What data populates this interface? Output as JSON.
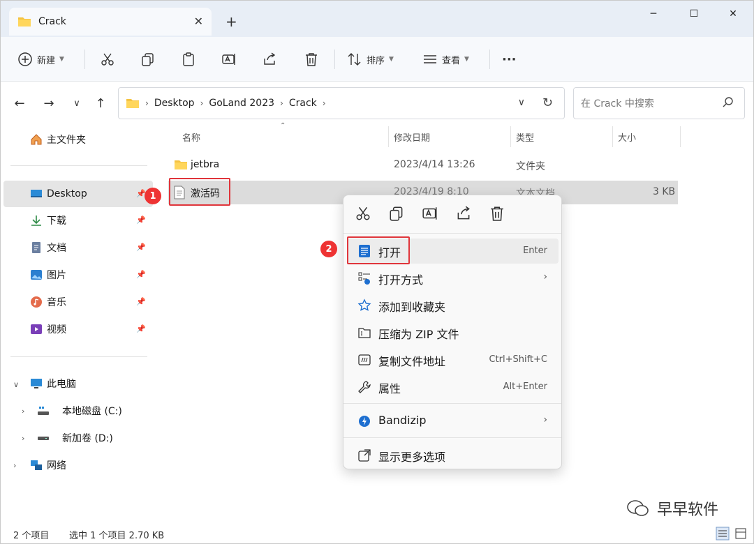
{
  "window": {
    "tab_title": "Crack",
    "new_tab": "+",
    "minimize": "─",
    "maximize": "☐",
    "close": "✕",
    "tab_close": "✕"
  },
  "toolbar": {
    "new_label": "新建",
    "sort_label": "排序",
    "view_label": "查看",
    "more_label": "···"
  },
  "address": {
    "crumbs": [
      "Desktop",
      "GoLand 2023",
      "Crack"
    ],
    "search_placeholder": "在 Crack 中搜索"
  },
  "sidebar": {
    "home": "主文件夹",
    "quick": [
      {
        "label": "Desktop",
        "icon": "desktop-icon"
      },
      {
        "label": "下载",
        "icon": "download-icon"
      },
      {
        "label": "文档",
        "icon": "document-icon"
      },
      {
        "label": "图片",
        "icon": "picture-icon"
      },
      {
        "label": "音乐",
        "icon": "music-icon"
      },
      {
        "label": "视频",
        "icon": "video-icon"
      }
    ],
    "this_pc": "此电脑",
    "drives": [
      {
        "label": "本地磁盘 (C:)"
      },
      {
        "label": "新加卷 (D:)"
      }
    ],
    "network": "网络"
  },
  "columns": {
    "name": "名称",
    "modified": "修改日期",
    "type": "类型",
    "size": "大小"
  },
  "files": [
    {
      "name": "jetbra",
      "modified": "2023/4/14 13:26",
      "type": "文件夹",
      "size": ""
    },
    {
      "name": "激活码",
      "modified": "2023/4/19 8:10",
      "type": "文本文档",
      "size": "3 KB"
    }
  ],
  "badges": {
    "one": "1",
    "two": "2"
  },
  "context_menu": {
    "items": [
      {
        "label": "打开",
        "shortcut": "Enter",
        "icon": "notepad-icon"
      },
      {
        "label": "打开方式",
        "shortcut": "",
        "icon": "open-with-icon"
      },
      {
        "label": "添加到收藏夹",
        "shortcut": "",
        "icon": "star-icon"
      },
      {
        "label": "压缩为 ZIP 文件",
        "shortcut": "",
        "icon": "zip-icon"
      },
      {
        "label": "复制文件地址",
        "shortcut": "Ctrl+Shift+C",
        "icon": "copy-path-icon"
      },
      {
        "label": "属性",
        "shortcut": "Alt+Enter",
        "icon": "wrench-icon"
      }
    ],
    "bandizip": "Bandizip",
    "more": "显示更多选项",
    "arrow": "›"
  },
  "status": {
    "count": "2 个项目",
    "selected": "选中 1 个项目  2.70 KB"
  },
  "watermark": "早早软件",
  "colors": {
    "accent": "#0067c0",
    "badge": "#e33333",
    "selection": "#dcdcdc"
  }
}
